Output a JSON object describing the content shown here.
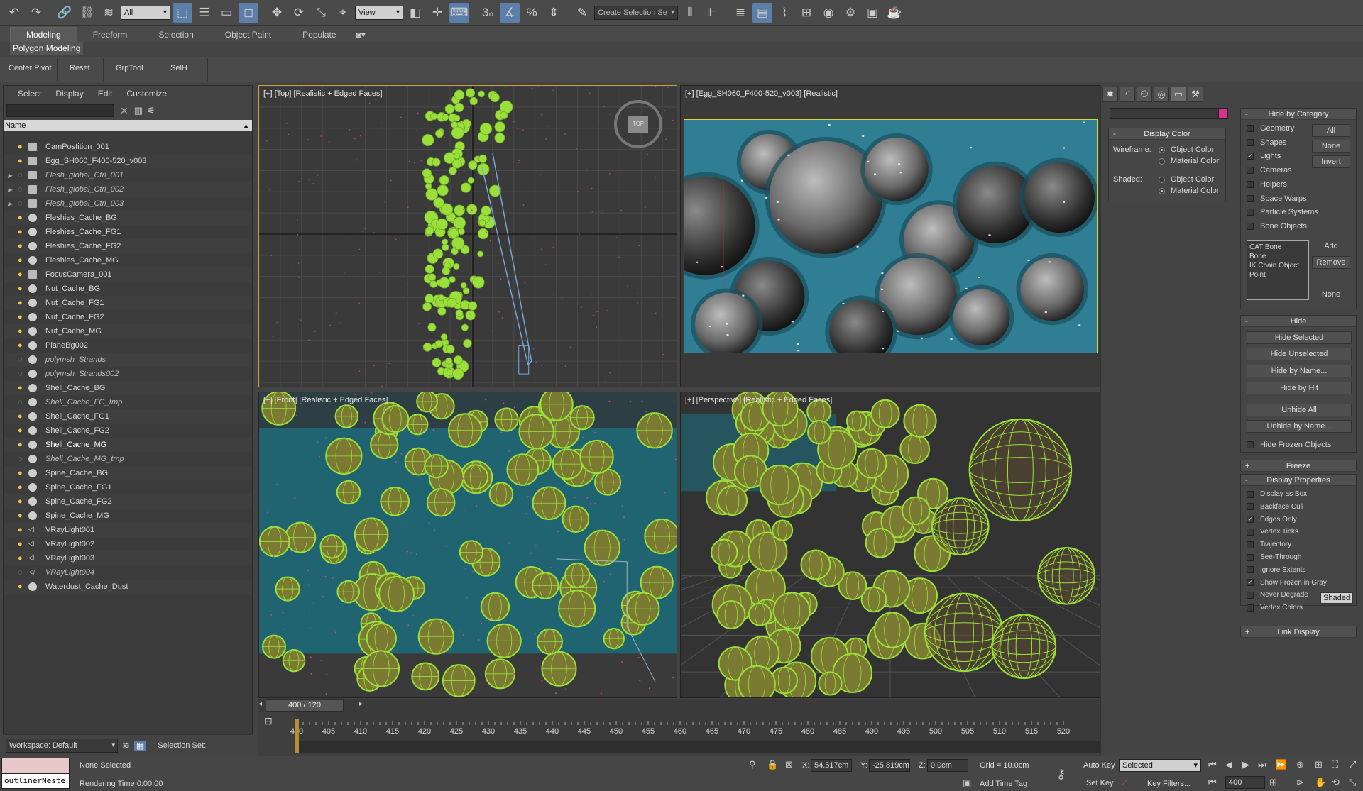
{
  "toolbar": {
    "selection_filter": "All",
    "ref_coord": "View",
    "named_selection_placeholder": "Create Selection Se",
    "snap_label": "3"
  },
  "ribbon": {
    "tabs": [
      "Modeling",
      "Freeform",
      "Selection",
      "Object Paint",
      "Populate"
    ],
    "sub_label": "Polygon Modeling",
    "buttons": [
      "Center Pivot",
      "Reset",
      "GrpTool",
      "SelH"
    ]
  },
  "outliner": {
    "menu": [
      "Select",
      "Display",
      "Edit",
      "Customize"
    ],
    "column_name": "Name",
    "items": [
      {
        "name": "CamPostition_001",
        "style": "normal",
        "expand": false,
        "type": "camera"
      },
      {
        "name": "Egg_SH060_F400-520_v003",
        "style": "normal",
        "expand": false,
        "type": "camera"
      },
      {
        "name": "Flesh_global_Ctrl_001",
        "style": "frozen",
        "expand": true,
        "type": "box"
      },
      {
        "name": "Flesh_global_Ctrl_002",
        "style": "frozen",
        "expand": true,
        "type": "box"
      },
      {
        "name": "Flesh_global_Ctrl_003",
        "style": "frozen",
        "expand": true,
        "type": "box"
      },
      {
        "name": "Fleshies_Cache_BG",
        "style": "normal",
        "expand": false,
        "type": "geo"
      },
      {
        "name": "Fleshies_Cache_FG1",
        "style": "normal",
        "expand": false,
        "type": "geo"
      },
      {
        "name": "Fleshies_Cache_FG2",
        "style": "normal",
        "expand": false,
        "type": "geo"
      },
      {
        "name": "Fleshies_Cache_MG",
        "style": "normal",
        "expand": false,
        "type": "geo"
      },
      {
        "name": "FocusCamera_001",
        "style": "normal",
        "expand": false,
        "type": "camera"
      },
      {
        "name": "Nut_Cache_BG",
        "style": "normal",
        "expand": false,
        "type": "geo"
      },
      {
        "name": "Nut_Cache_FG1",
        "style": "normal",
        "expand": false,
        "type": "geo"
      },
      {
        "name": "Nut_Cache_FG2",
        "style": "normal",
        "expand": false,
        "type": "geo"
      },
      {
        "name": "Nut_Cache_MG",
        "style": "normal",
        "expand": false,
        "type": "geo"
      },
      {
        "name": "PlaneBg002",
        "style": "normal",
        "expand": false,
        "type": "geo"
      },
      {
        "name": "polymsh_Strands",
        "style": "frozen",
        "expand": false,
        "type": "geo"
      },
      {
        "name": "polymsh_Strands002",
        "style": "frozen",
        "expand": false,
        "type": "geo"
      },
      {
        "name": "Shell_Cache_BG",
        "style": "normal",
        "expand": false,
        "type": "geo"
      },
      {
        "name": "Shell_Cache_FG_tmp",
        "style": "frozen",
        "expand": false,
        "type": "geo"
      },
      {
        "name": "Shell_Cache_FG1",
        "style": "normal",
        "expand": false,
        "type": "geo"
      },
      {
        "name": "Shell_Cache_FG2",
        "style": "normal",
        "expand": false,
        "type": "geo"
      },
      {
        "name": "Shell_Cache_MG",
        "style": "bold",
        "expand": false,
        "type": "geo"
      },
      {
        "name": "Shell_Cache_MG_tmp",
        "style": "frozen",
        "expand": false,
        "type": "geo"
      },
      {
        "name": "Spine_Cache_BG",
        "style": "normal",
        "expand": false,
        "type": "geo"
      },
      {
        "name": "Spine_Cache_FG1",
        "style": "normal",
        "expand": false,
        "type": "geo"
      },
      {
        "name": "Spine_Cache_FG2",
        "style": "normal",
        "expand": false,
        "type": "geo"
      },
      {
        "name": "Spine_Cache_MG",
        "style": "normal",
        "expand": false,
        "type": "geo"
      },
      {
        "name": "VRayLight001",
        "style": "normal",
        "expand": false,
        "type": "light"
      },
      {
        "name": "VRayLight002",
        "style": "normal",
        "expand": false,
        "type": "light"
      },
      {
        "name": "VRayLight003",
        "style": "normal",
        "expand": false,
        "type": "light"
      },
      {
        "name": "VRayLight004",
        "style": "frozen",
        "expand": false,
        "type": "light"
      },
      {
        "name": "Waterdust_Cache_Dust",
        "style": "normal",
        "expand": false,
        "type": "geo"
      }
    ],
    "workspace": "Workspace: Default",
    "selection_set": "Selection Set:"
  },
  "viewports": {
    "top": "[+] [Top] [Realistic + Edged Faces]",
    "camera": "[+] [Egg_SH060_F400-520_v003] [Realistic]",
    "front": "[+] [Front] [Realistic + Edged Faces]",
    "perspective": "[+] [Perspective] [Realistic + Edged Faces]",
    "viewcube_label": "TOP"
  },
  "command_panel": {
    "display_color": {
      "title": "Display Color",
      "wireframe_label": "Wireframe:",
      "shaded_label": "Shaded:",
      "object_color": "Object Color",
      "material_color": "Material Color"
    },
    "hide_by_category": {
      "title": "Hide by Category",
      "items": [
        {
          "label": "Geometry",
          "checked": false
        },
        {
          "label": "Shapes",
          "checked": false
        },
        {
          "label": "Lights",
          "checked": true
        },
        {
          "label": "Cameras",
          "checked": false
        },
        {
          "label": "Helpers",
          "checked": false
        },
        {
          "label": "Space Warps",
          "checked": false
        },
        {
          "label": "Particle Systems",
          "checked": false
        },
        {
          "label": "Bone Objects",
          "checked": false
        }
      ],
      "btn_all": "All",
      "btn_none": "None",
      "btn_invert": "Invert",
      "list": [
        "CAT Bone",
        "Bone",
        "IK Chain Object",
        "Point"
      ],
      "btn_add": "Add",
      "btn_remove": "Remove",
      "btn_none2": "None"
    },
    "hide": {
      "title": "Hide",
      "buttons": [
        "Hide Selected",
        "Hide Unselected",
        "Hide by Name...",
        "Hide by Hit",
        "Unhide All",
        "Unhide by Name..."
      ],
      "hide_frozen": "Hide Frozen Objects"
    },
    "freeze": {
      "title": "Freeze"
    },
    "display_properties": {
      "title": "Display Properties",
      "items": [
        {
          "label": "Display as Box",
          "checked": false
        },
        {
          "label": "Backface Cull",
          "checked": false
        },
        {
          "label": "Edges Only",
          "checked": true
        },
        {
          "label": "Vertex Ticks",
          "checked": false
        },
        {
          "label": "Trajectory",
          "checked": false
        },
        {
          "label": "See-Through",
          "checked": false
        },
        {
          "label": "Ignore Extents",
          "checked": false
        },
        {
          "label": "Show Frozen in Gray",
          "checked": true
        },
        {
          "label": "Never Degrade",
          "checked": false
        },
        {
          "label": "Vertex Colors",
          "checked": false
        }
      ],
      "shaded_btn": "Shaded"
    },
    "link_display": {
      "title": "Link Display"
    }
  },
  "timeline": {
    "slider_label": "400 / 120",
    "ticks": [
      400,
      405,
      410,
      415,
      420,
      425,
      430,
      435,
      440,
      445,
      450,
      455,
      460,
      465,
      470,
      475,
      480,
      485,
      490,
      495,
      500,
      505,
      510,
      515,
      520
    ],
    "current_frame": 400
  },
  "status": {
    "maxscript": "outlinerNeste",
    "none_selected": "None Selected",
    "rendering_time": "Rendering Time  0:00:00",
    "x_label": "X:",
    "x_value": "54.517cm",
    "y_label": "Y:",
    "y_value": "-25.819cm",
    "z_label": "Z:",
    "z_value": "0.0cm",
    "grid": "Grid = 10.0cm",
    "add_time_tag": "Add Time Tag",
    "auto_key": "Auto Key",
    "set_key": "Set Key",
    "key_mode": "Selected",
    "key_filters": "Key Filters...",
    "frame_field": "400"
  },
  "colors": {
    "accent": "#5b7fa8",
    "active_viewport_border": "#c8a038",
    "wire_green": "#9be03a",
    "water_teal": "#2f7e93"
  }
}
